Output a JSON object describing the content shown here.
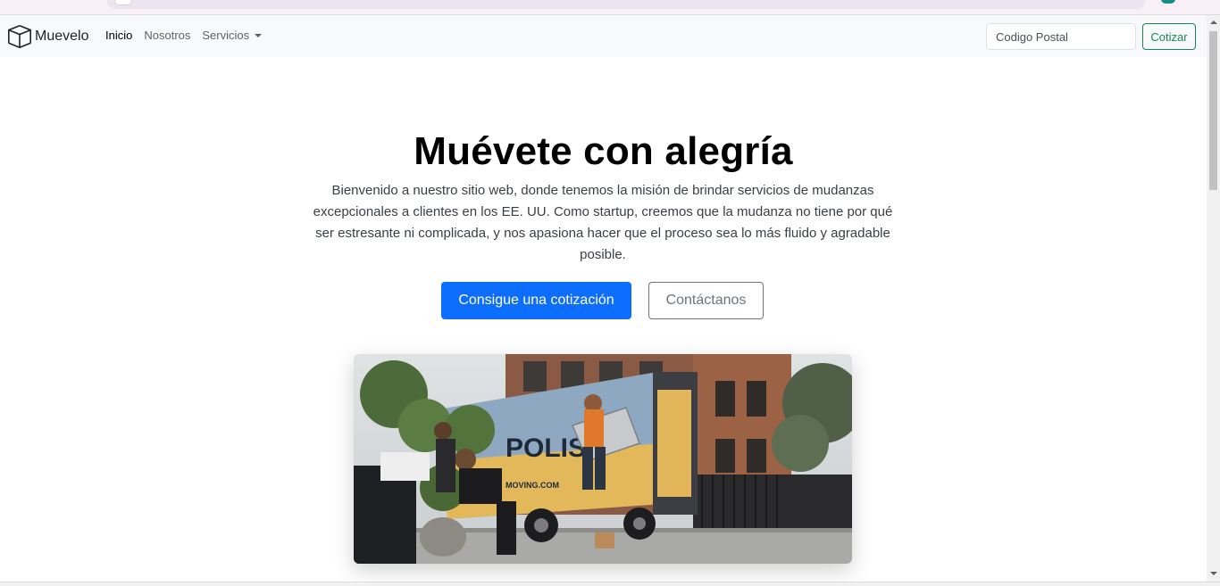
{
  "navbar": {
    "brand": "Muevelo",
    "links": [
      {
        "label": "Inicio",
        "active": true
      },
      {
        "label": "Nosotros",
        "active": false
      },
      {
        "label": "Servicios",
        "dropdown": true
      }
    ],
    "search_placeholder": "Codigo Postal",
    "quote_button": "Cotizar"
  },
  "hero": {
    "title": "Muévete con alegría",
    "text": "Bienvenido a nuestro sitio web, donde tenemos la misión de brindar servicios de mudanzas excepcionales a clientes en los EE. UU. Como startup, creemos que la mudanza no tiene por qué ser estresante ni complicada, y nos apasiona hacer que el proceso sea lo más fluido y agradable posible.",
    "primary_button": "Consigue una cotización",
    "secondary_button": "Contáctanos"
  },
  "image": {
    "truck_text": "POLIS",
    "truck_url": "MOVING.COM"
  },
  "colors": {
    "primary": "#0d6efd",
    "success": "#198754",
    "secondary": "#6c757d",
    "navbar_bg": "#f8f9fa"
  }
}
